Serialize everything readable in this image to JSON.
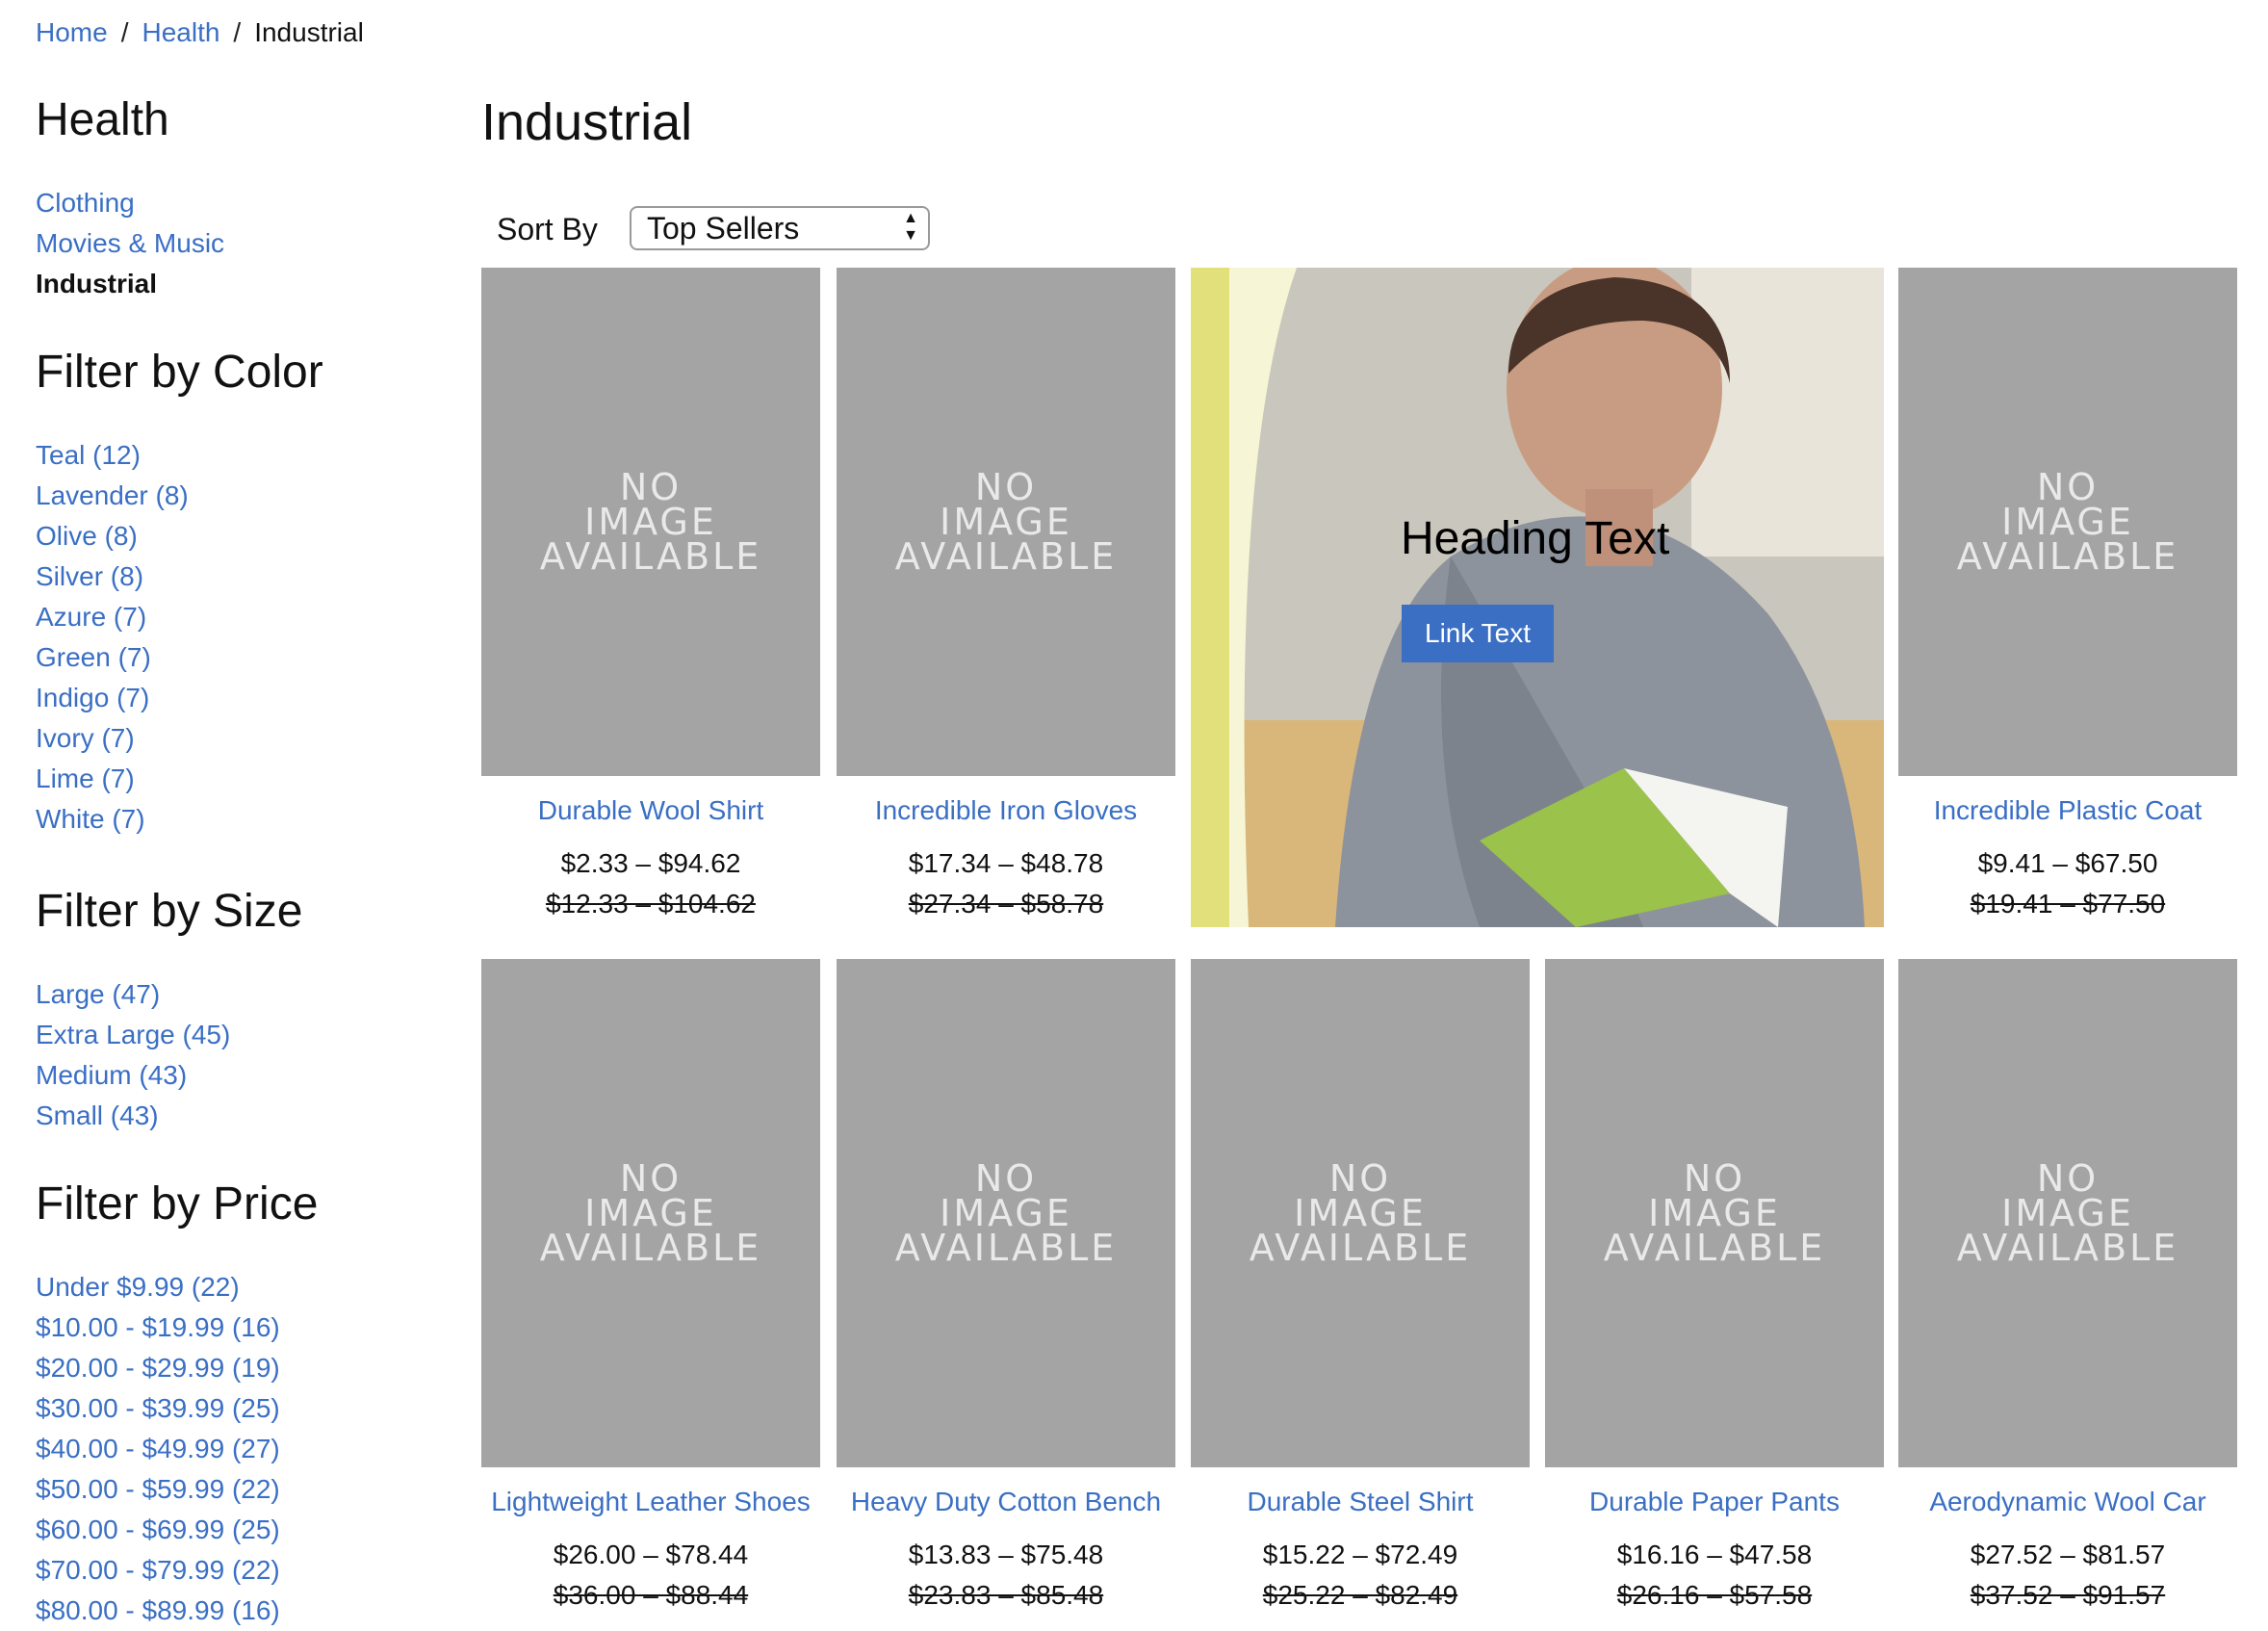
{
  "breadcrumb": {
    "items": [
      "Home",
      "Health"
    ],
    "current": "Industrial",
    "separator": "/"
  },
  "sidebar": {
    "category_title": "Health",
    "categories": [
      {
        "label": "Clothing",
        "active": false
      },
      {
        "label": "Movies & Music",
        "active": false
      },
      {
        "label": "Industrial",
        "active": true
      }
    ],
    "color_title": "Filter by Color",
    "colors": [
      "Teal (12)",
      "Lavender (8)",
      "Olive (8)",
      "Silver (8)",
      "Azure (7)",
      "Green (7)",
      "Indigo (7)",
      "Ivory (7)",
      "Lime (7)",
      "White (7)"
    ],
    "size_title": "Filter by Size",
    "sizes": [
      "Large (47)",
      "Extra Large (45)",
      "Medium (43)",
      "Small (43)"
    ],
    "price_title": "Filter by Price",
    "prices": [
      "Under $9.99 (22)",
      "$10.00 - $19.99 (16)",
      "$20.00 - $29.99 (19)",
      "$30.00 - $39.99 (25)",
      "$40.00 - $49.99 (27)",
      "$50.00 - $59.99 (22)",
      "$60.00 - $69.99 (25)",
      "$70.00 - $79.99 (22)",
      "$80.00 - $89.99 (16)"
    ]
  },
  "main": {
    "title": "Industrial",
    "sort_label": "Sort By",
    "sort_value": "Top Sellers",
    "no_image_text": [
      "NO",
      "IMAGE",
      "AVAILABLE"
    ],
    "promo": {
      "heading": "Heading Text",
      "link": "Link Text"
    },
    "products": [
      {
        "name": "Durable Wool Shirt",
        "price": "$2.33 – $94.62",
        "old_price": "$12.33 – $104.62"
      },
      {
        "name": "Incredible Iron Gloves",
        "price": "$17.34 – $48.78",
        "old_price": "$27.34 – $58.78"
      },
      {
        "name": "Incredible Plastic Coat",
        "price": "$9.41 – $67.50",
        "old_price": "$19.41 – $77.50"
      },
      {
        "name": "Lightweight Leather Shoes",
        "price": "$26.00 – $78.44",
        "old_price": "$36.00 – $88.44"
      },
      {
        "name": "Heavy Duty Cotton Bench",
        "price": "$13.83 – $75.48",
        "old_price": "$23.83 – $85.48"
      },
      {
        "name": "Durable Steel Shirt",
        "price": "$15.22 – $72.49",
        "old_price": "$25.22 – $82.49"
      },
      {
        "name": "Durable Paper Pants",
        "price": "$16.16 – $47.58",
        "old_price": "$26.16 – $57.58"
      },
      {
        "name": "Aerodynamic Wool Car",
        "price": "$27.52 – $81.57",
        "old_price": "$37.52 – $91.57"
      }
    ]
  },
  "colors": {
    "link": "#3a6fc4",
    "placeholder": "#a4a4a4",
    "button": "#3a6fc4"
  }
}
